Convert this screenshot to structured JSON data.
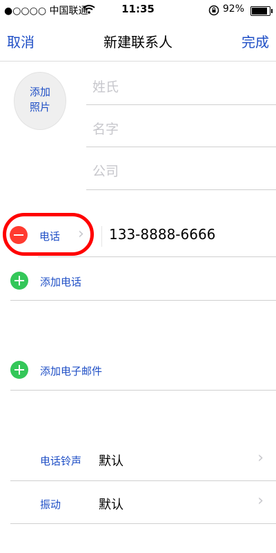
{
  "status": {
    "carrier": "●○○○○ 中国联通 ",
    "time": "11:35",
    "battery_pct": "92%"
  },
  "nav": {
    "cancel": "取消",
    "title": "新建联系人",
    "done": "完成"
  },
  "photo": {
    "line1": "添加",
    "line2": "照片"
  },
  "fields": {
    "last_name": "姓氏",
    "first_name": "名字",
    "company": "公司"
  },
  "phone": {
    "label": "电话",
    "value": "133-8888-6666"
  },
  "add": {
    "phone": "添加电话",
    "email": "添加电子邮件"
  },
  "settings": {
    "ringtone_label": "电话铃声",
    "ringtone_value": "默认",
    "vibration_label": "振动",
    "vibration_value": "默认"
  },
  "icons": {
    "remove": "minus-circle-icon",
    "add": "plus-circle-icon",
    "chevron": "chevron-right-icon",
    "wifi": "wifi-icon",
    "lock": "rotation-lock-icon"
  },
  "colors": {
    "accent": "#1f4fc6",
    "remove": "#ff3b30",
    "add": "#34c759",
    "highlight": "#ff0000"
  }
}
